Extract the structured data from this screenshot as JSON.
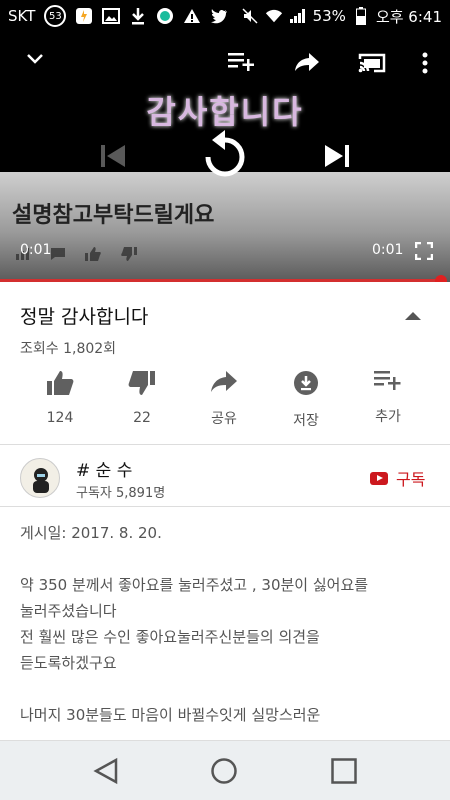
{
  "status_bar": {
    "carrier": "SKT",
    "notification_count": "53",
    "battery": "53%",
    "time": "오후 6:41"
  },
  "player": {
    "video_overlay_title": "감사합니다",
    "video_overlay_caption": "설명참고부탁드릴게요",
    "current_time": "0:01",
    "duration": "0:01",
    "progress": 0.98
  },
  "video": {
    "title": "정말 감사합니다",
    "views": "조회수 1,802회"
  },
  "actions": {
    "like_count": "124",
    "dislike_count": "22",
    "share_label": "공유",
    "save_label": "저장",
    "add_label": "추가"
  },
  "channel": {
    "name": "# 순 수",
    "subscribers": "구독자 5,891명",
    "subscribe_label": "구독"
  },
  "description": {
    "published": "게시일: 2017. 8. 20.",
    "line1": "약 350 분께서 좋아요를 눌러주셨고 , 30분이 싫어요를",
    "line2": "눌러주셨습니다",
    "line3": "전 훨씬 많은 수인 좋아요눌러주신분들의 의견을",
    "line4": "듣도록하겠구요",
    "line5": "나머지 30분들도 마음이 바뀔수잇게 실망스러운"
  }
}
